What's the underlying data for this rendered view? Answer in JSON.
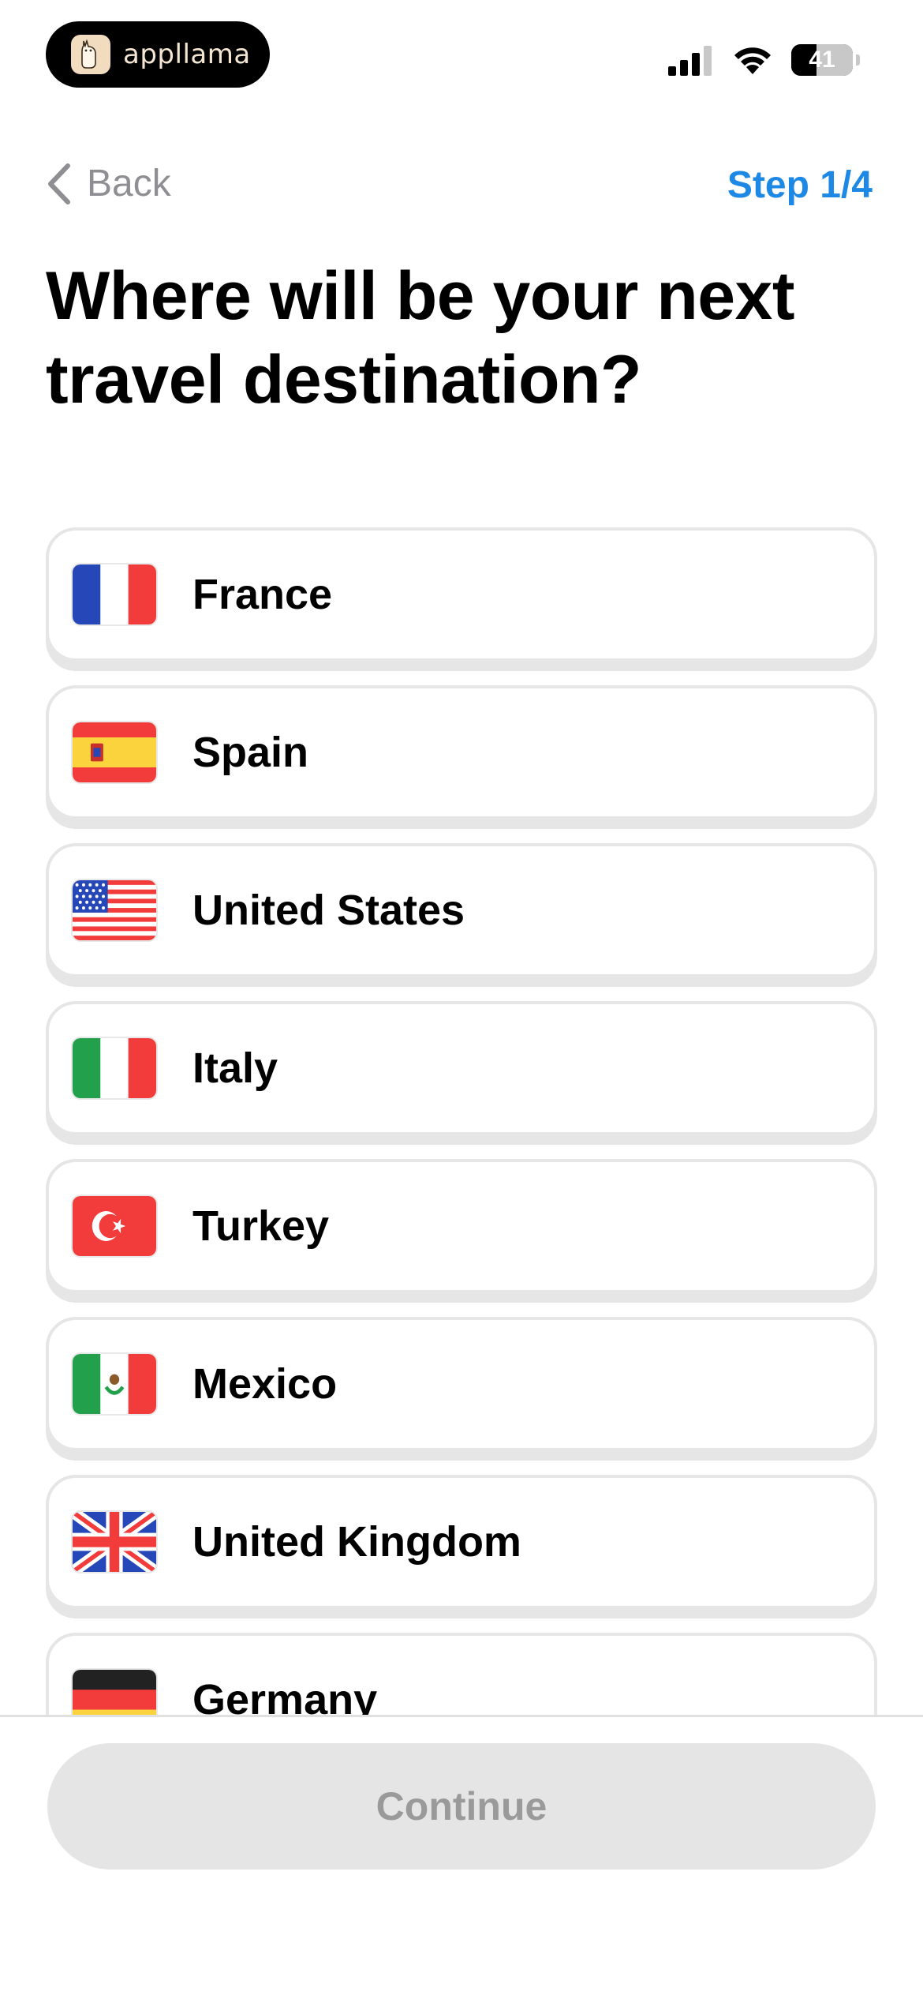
{
  "status_bar": {
    "brand_name": "appllama",
    "battery_level": "41"
  },
  "nav": {
    "back_label": "Back",
    "step_label": "Step 1/4"
  },
  "title": "Where will be your next travel destination?",
  "options": [
    {
      "label": "France",
      "flag": "france-flag-icon"
    },
    {
      "label": "Spain",
      "flag": "spain-flag-icon"
    },
    {
      "label": "United States",
      "flag": "usa-flag-icon"
    },
    {
      "label": "Italy",
      "flag": "italy-flag-icon"
    },
    {
      "label": "Turkey",
      "flag": "turkey-flag-icon"
    },
    {
      "label": "Mexico",
      "flag": "mexico-flag-icon"
    },
    {
      "label": "United Kingdom",
      "flag": "uk-flag-icon"
    },
    {
      "label": "Germany",
      "flag": "germany-flag-icon"
    }
  ],
  "continue_label": "Continue",
  "colors": {
    "accent": "#1e88e5",
    "card_border": "#e6e6e6",
    "disabled_button": "#e5e5e5",
    "disabled_text": "#9a9a9a"
  }
}
